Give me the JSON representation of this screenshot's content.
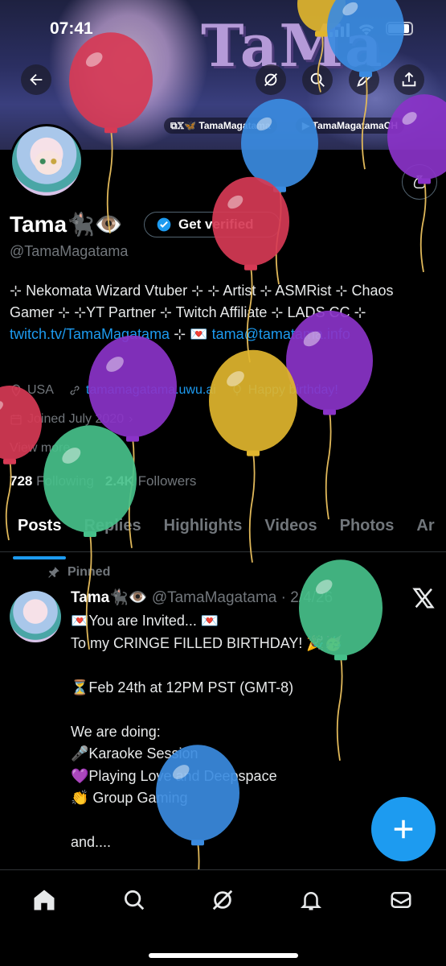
{
  "status_bar": {
    "time": "07:41"
  },
  "banner": {
    "logo_text": "TaMa",
    "handle_twitch_x": "TamaMagatama",
    "handle_youtube": "TamaMagatamaCH"
  },
  "profile": {
    "name": "Tama🐈‍⬛👁️",
    "get_verified_label": "Get verified",
    "handle": "@TamaMagatama",
    "bio_part1": "⊹ Nekomata Wizard Vtuber ⊹ ⊹ Artist ⊹ ASMRist ⊹ Chaos Gamer ⊹ ⊹YT Partner ⊹ Twitch Affiliate ⊹ LADS CC ⊹ ",
    "bio_link": "twitch.tv/TamaMagatama",
    "bio_part2": " ⊹ 💌 ",
    "bio_email": "tama@tamatama.info",
    "location": "USA",
    "website": "tamamagatama.uwu.ai",
    "birthday": "Happy birthday!",
    "joined": "Joined July 2020",
    "view_more": "View more",
    "following_count": "728",
    "following_label": "Following",
    "followers_count": "2.4K",
    "followers_label": "Followers"
  },
  "tabs": [
    {
      "label": "Posts",
      "active": true
    },
    {
      "label": "Replies"
    },
    {
      "label": "Highlights"
    },
    {
      "label": "Videos"
    },
    {
      "label": "Photos"
    },
    {
      "label": "Ar"
    }
  ],
  "post": {
    "pinned_label": "Pinned",
    "author": "Tama🐈‍⬛👁️",
    "handle_date": "@TamaMagatama · 2/4/26",
    "body": "💌You are Invited... 💌\nTo my CRINGE FILLED BIRTHDAY! 🎉🥳\n\n⏳Feb 24th at 12PM PST (GMT-8)\n\nWe are doing:\n🎤Karaoke Session\n💜Playing Love and Deepspace\n👏 Group Gaming\n\nand...."
  },
  "icons": {
    "back": "back-arrow-icon",
    "grok": "grok-icon",
    "search": "search-icon",
    "compose": "compose-icon",
    "share": "share-icon",
    "gift": "money-bag-icon",
    "verified": "verified-badge-icon",
    "location": "location-icon",
    "link": "link-icon",
    "birthday": "balloon-icon",
    "calendar": "calendar-icon",
    "pin": "pin-icon",
    "x_logo": "x-logo-icon",
    "fab_plus": "plus-icon",
    "nav": [
      "home-icon",
      "search-icon",
      "grok-icon",
      "bell-icon",
      "mail-icon"
    ]
  },
  "colors": {
    "accent": "#1d9bf0",
    "muted": "#71767b",
    "background": "#000000",
    "balloon_red": "#d63a55",
    "balloon_blue": "#3b8be0",
    "balloon_purple": "#8a33c8",
    "balloon_yellow": "#e0b52e",
    "balloon_green": "#46c08a"
  }
}
